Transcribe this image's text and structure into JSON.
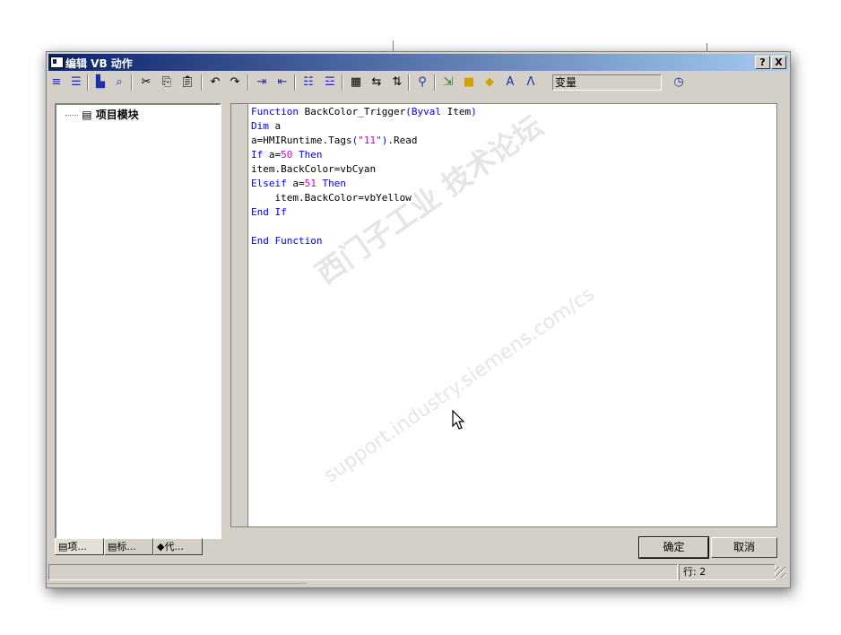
{
  "window": {
    "title": "编辑 VB 动作",
    "help_label": "?",
    "close_label": "X"
  },
  "toolbar": {
    "icons": [
      "menu-icon",
      "align-icon",
      "print-icon",
      "print-preview-icon",
      "cut-icon",
      "copy-icon",
      "paste-icon",
      "undo-icon",
      "redo-icon",
      "indent-icon",
      "outdent-icon",
      "comment-icon",
      "uncomment-icon",
      "find-icon",
      "replace-icon",
      "goto-icon",
      "syntax-check-icon",
      "compile-icon",
      "cube-icon",
      "cube-config-icon",
      "font-icon",
      "tag-icon",
      "clock-icon"
    ],
    "variable_label": "变量"
  },
  "tree": {
    "root_label": "项目模块"
  },
  "tabs": [
    {
      "label": "项..."
    },
    {
      "label": "标..."
    },
    {
      "label": "代..."
    }
  ],
  "code_lines": [
    "Function BackColor_Trigger(Byval Item)",
    "Dim a",
    "a=HMIRuntime.Tags(\"11\").Read",
    "If a=50 Then",
    "item.BackColor=vbCyan",
    "Elseif a=51 Then",
    "    item.BackColor=vbYellow",
    "End If",
    "",
    "End Function"
  ],
  "buttons": {
    "ok_label": "确定",
    "cancel_label": "取消"
  },
  "status": {
    "line": "行: 2"
  },
  "watermark": {
    "line1": "西门子工业 技术论坛",
    "line2": "support.industry.siemens.com/cs"
  },
  "colors": {
    "keyword": "#0000ff",
    "literal": "#d000d0",
    "title_start": "#0a246a",
    "title_end": "#a6caf0"
  }
}
